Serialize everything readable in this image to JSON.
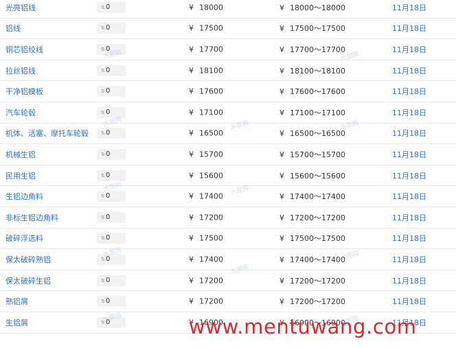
{
  "currency_symbol": "¥",
  "rows": [
    {
      "name": "光亮铝线",
      "change": "0",
      "price": "18000",
      "range": "18000～18000",
      "date": "11月18日"
    },
    {
      "name": "铝线",
      "change": "0",
      "price": "17500",
      "range": "17500～17500",
      "date": "11月18日"
    },
    {
      "name": "铜芯铝绞线",
      "change": "0",
      "price": "17700",
      "range": "17700～17700",
      "date": "11月18日"
    },
    {
      "name": "拉丝铝线",
      "change": "0",
      "price": "18100",
      "range": "18100～18100",
      "date": "11月18日"
    },
    {
      "name": "干净铝模板",
      "change": "0",
      "price": "17600",
      "range": "17600～17600",
      "date": "11月18日"
    },
    {
      "name": "汽车轮毂",
      "change": "0",
      "price": "17100",
      "range": "17100～17100",
      "date": "11月18日"
    },
    {
      "name": "机体、活塞、摩托车轮毂",
      "change": "0",
      "price": "16500",
      "range": "16500～16500",
      "date": "11月18日"
    },
    {
      "name": "机械生铝",
      "change": "0",
      "price": "15700",
      "range": "15700～15700",
      "date": "11月18日"
    },
    {
      "name": "民用生铝",
      "change": "0",
      "price": "15600",
      "range": "15600～15600",
      "date": "11月18日"
    },
    {
      "name": "生铝边角料",
      "change": "0",
      "price": "17400",
      "range": "17400～17400",
      "date": "11月18日"
    },
    {
      "name": "非标生铝边角料",
      "change": "0",
      "price": "17200",
      "range": "17200～17200",
      "date": "11月18日"
    },
    {
      "name": "破碎浮选料",
      "change": "0",
      "price": "17500",
      "range": "17500～17500",
      "date": "11月18日"
    },
    {
      "name": "保太破碎熟铝",
      "change": "0",
      "price": "17400",
      "range": "17400～17400",
      "date": "11月18日"
    },
    {
      "name": "保太破碎生铝",
      "change": "0",
      "price": "17200",
      "range": "17200～17200",
      "date": "11月18日"
    },
    {
      "name": "熟铝屑",
      "change": "0",
      "price": "17200",
      "range": "17200～17200",
      "date": "11月18日"
    },
    {
      "name": "生铝屑",
      "change": "0",
      "price": "16900",
      "range": "16900～16900",
      "date": "11月18日"
    }
  ],
  "watermark_text": "大部网",
  "brand_overlay": "www.mentuwang.com",
  "colors": {
    "link": "#3273c8",
    "brand": "#e2262a",
    "divider": "#e6e6e6"
  }
}
